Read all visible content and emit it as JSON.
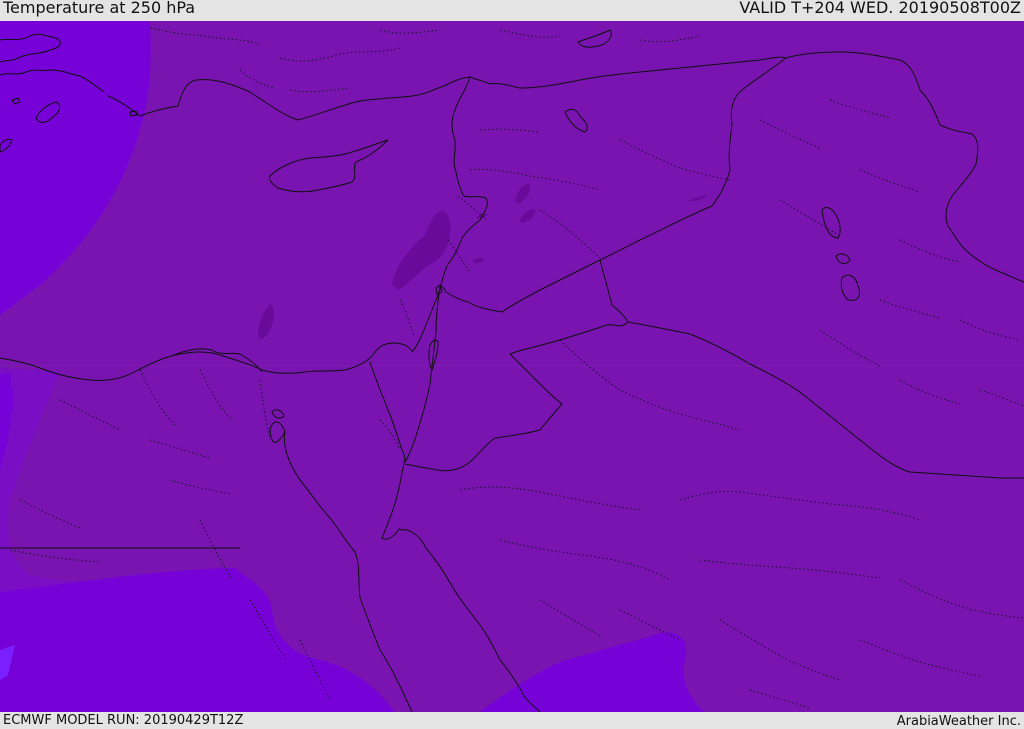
{
  "header": {
    "title": "Temperature at 250 hPa",
    "valid": "VALID T+204 WED. 20190508T00Z"
  },
  "footer": {
    "model_run": "ECMWF MODEL RUN: 20190429T12Z",
    "credit": "ArabiaWeather Inc."
  },
  "map": {
    "colors": {
      "base_band": "#7a14b0",
      "cold_band": "#7702d8",
      "mid_band": "#7a0ec4",
      "warm_patch": "#6a0a9a",
      "coastline": "#101010",
      "admin_border": "#1a1030"
    }
  }
}
